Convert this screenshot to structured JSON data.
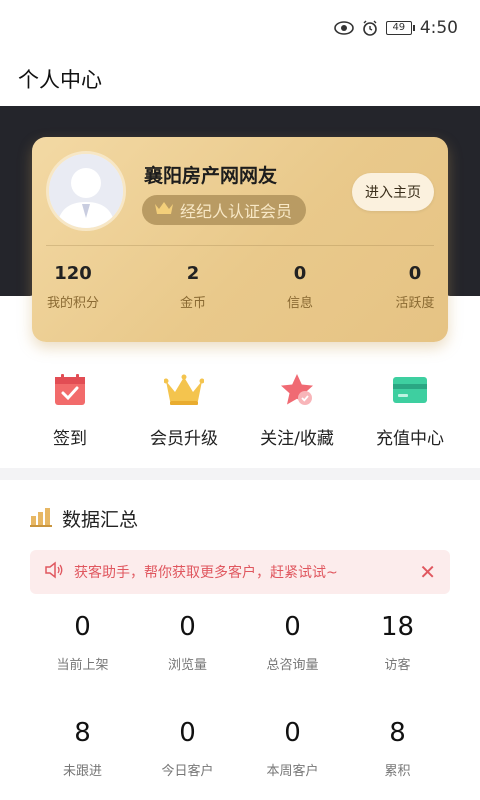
{
  "status_bar": {
    "battery": "49",
    "time": "4:50",
    "icons": [
      "eye-icon",
      "alarm-icon",
      "battery-icon"
    ]
  },
  "header": {
    "title": "个人中心"
  },
  "profile": {
    "name": "襄阳房产网网友",
    "badge": "经纪人认证会员",
    "home_button": "进入主页",
    "stats": [
      {
        "value": "120",
        "label": "我的积分"
      },
      {
        "value": "2",
        "label": "金币"
      },
      {
        "value": "0",
        "label": "信息"
      },
      {
        "value": "0",
        "label": "活跃度"
      }
    ]
  },
  "actions": [
    {
      "label": "签到",
      "icon": "calendar-check-icon"
    },
    {
      "label": "会员升级",
      "icon": "crown-icon"
    },
    {
      "label": "关注/收藏",
      "icon": "star-icon"
    },
    {
      "label": "充值中心",
      "icon": "card-icon"
    }
  ],
  "summary": {
    "title": "数据汇总",
    "notice": "获客助手，帮你获取更多客户，赶紧试试~",
    "close": "✕",
    "items": [
      {
        "value": "0",
        "label": "当前上架"
      },
      {
        "value": "0",
        "label": "浏览量"
      },
      {
        "value": "0",
        "label": "总咨询量"
      },
      {
        "value": "18",
        "label": "访客"
      },
      {
        "value": "8",
        "label": "未跟进"
      },
      {
        "value": "0",
        "label": "今日客户"
      },
      {
        "value": "0",
        "label": "本周客户"
      },
      {
        "value": "8",
        "label": "累积"
      }
    ]
  },
  "colors": {
    "card_gold": "#e9c98b",
    "dark_band": "#24252b",
    "notice_bg": "#fcecec",
    "notice_text": "#e0575f"
  }
}
